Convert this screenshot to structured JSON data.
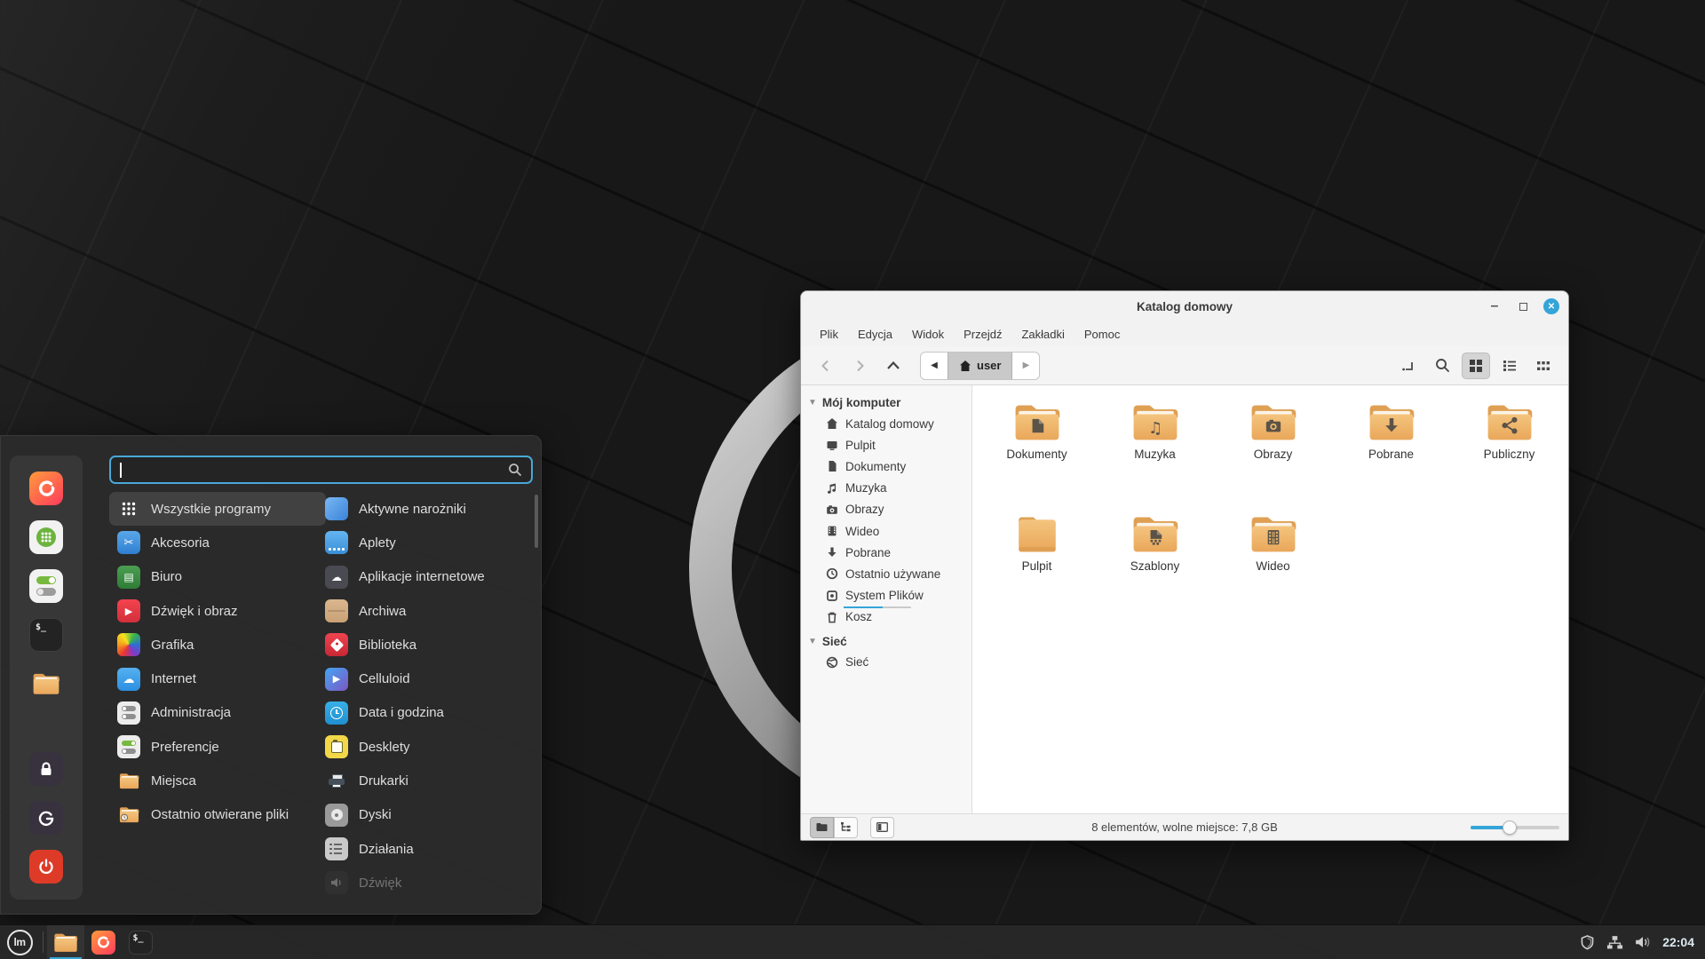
{
  "theme": {
    "accent": "#35a5d8",
    "folder_color": "#efb363",
    "panel_bg": "#282828",
    "menu_bg": "#2b2b2b"
  },
  "start_menu": {
    "search_value": "",
    "favorites": [
      {
        "icon": "firefox-icon"
      },
      {
        "icon": "software-manager-icon"
      },
      {
        "icon": "system-settings-icon"
      },
      {
        "icon": "terminal-icon"
      },
      {
        "icon": "files-icon"
      },
      {
        "icon": "lock-screen-icon"
      },
      {
        "icon": "logout-icon"
      },
      {
        "icon": "shutdown-icon"
      }
    ],
    "categories": [
      {
        "label": "Wszystkie programy",
        "icon": "all-programs-icon",
        "selected": true
      },
      {
        "label": "Akcesoria",
        "icon": "accessories-icon"
      },
      {
        "label": "Biuro",
        "icon": "office-icon"
      },
      {
        "label": "Dźwięk i obraz",
        "icon": "audio-video-icon"
      },
      {
        "label": "Grafika",
        "icon": "graphics-icon"
      },
      {
        "label": "Internet",
        "icon": "internet-icon"
      },
      {
        "label": "Administracja",
        "icon": "administration-icon"
      },
      {
        "label": "Preferencje",
        "icon": "preferences-icon"
      },
      {
        "label": "Miejsca",
        "icon": "places-icon"
      },
      {
        "label": "Ostatnio otwierane pliki",
        "icon": "recent-files-icon"
      }
    ],
    "apps": [
      {
        "label": "Aktywne narożniki",
        "icon": "hot-corners-icon"
      },
      {
        "label": "Aplety",
        "icon": "applets-icon"
      },
      {
        "label": "Aplikacje internetowe",
        "icon": "webapps-icon"
      },
      {
        "label": "Archiwa",
        "icon": "archive-icon"
      },
      {
        "label": "Biblioteka",
        "icon": "library-icon"
      },
      {
        "label": "Celluloid",
        "icon": "celluloid-icon"
      },
      {
        "label": "Data i godzina",
        "icon": "date-time-icon"
      },
      {
        "label": "Desklety",
        "icon": "desklets-icon"
      },
      {
        "label": "Drukarki",
        "icon": "printers-icon"
      },
      {
        "label": "Dyski",
        "icon": "disks-icon"
      },
      {
        "label": "Działania",
        "icon": "actions-icon"
      },
      {
        "label": "Dźwięk",
        "icon": "sound-icon"
      }
    ]
  },
  "window": {
    "title": "Katalog domowy",
    "menubar": [
      {
        "label": "Plik"
      },
      {
        "label": "Edycja"
      },
      {
        "label": "Widok"
      },
      {
        "label": "Przejdź"
      },
      {
        "label": "Zakładki"
      },
      {
        "label": "Pomoc"
      }
    ],
    "path_segment": "user",
    "sidebar": {
      "sections": [
        {
          "label": "Mój komputer",
          "items": [
            {
              "label": "Katalog domowy",
              "icon": "home-icon"
            },
            {
              "label": "Pulpit",
              "icon": "desktop-icon"
            },
            {
              "label": "Dokumenty",
              "icon": "document-icon"
            },
            {
              "label": "Muzyka",
              "icon": "music-icon"
            },
            {
              "label": "Obrazy",
              "icon": "camera-icon"
            },
            {
              "label": "Wideo",
              "icon": "film-icon"
            },
            {
              "label": "Pobrane",
              "icon": "download-icon"
            },
            {
              "label": "Ostatnio używane",
              "icon": "recent-icon"
            },
            {
              "label": "System Plików",
              "icon": "filesystem-icon"
            },
            {
              "label": "Kosz",
              "icon": "trash-icon"
            }
          ]
        },
        {
          "label": "Sieć",
          "items": [
            {
              "label": "Sieć",
              "icon": "network-globe-icon"
            }
          ]
        }
      ]
    },
    "files": [
      {
        "label": "Dokumenty",
        "emblem": "document"
      },
      {
        "label": "Muzyka",
        "emblem": "music"
      },
      {
        "label": "Obrazy",
        "emblem": "camera"
      },
      {
        "label": "Pobrane",
        "emblem": "download"
      },
      {
        "label": "Publiczny",
        "emblem": "share"
      },
      {
        "label": "Pulpit",
        "emblem": "none"
      },
      {
        "label": "Szablony",
        "emblem": "template"
      },
      {
        "label": "Wideo",
        "emblem": "film"
      }
    ],
    "statusbar": {
      "text": "8 elementów, wolne miejsce: 7,8 GB"
    }
  },
  "taskbar": {
    "clock": "22:04"
  }
}
